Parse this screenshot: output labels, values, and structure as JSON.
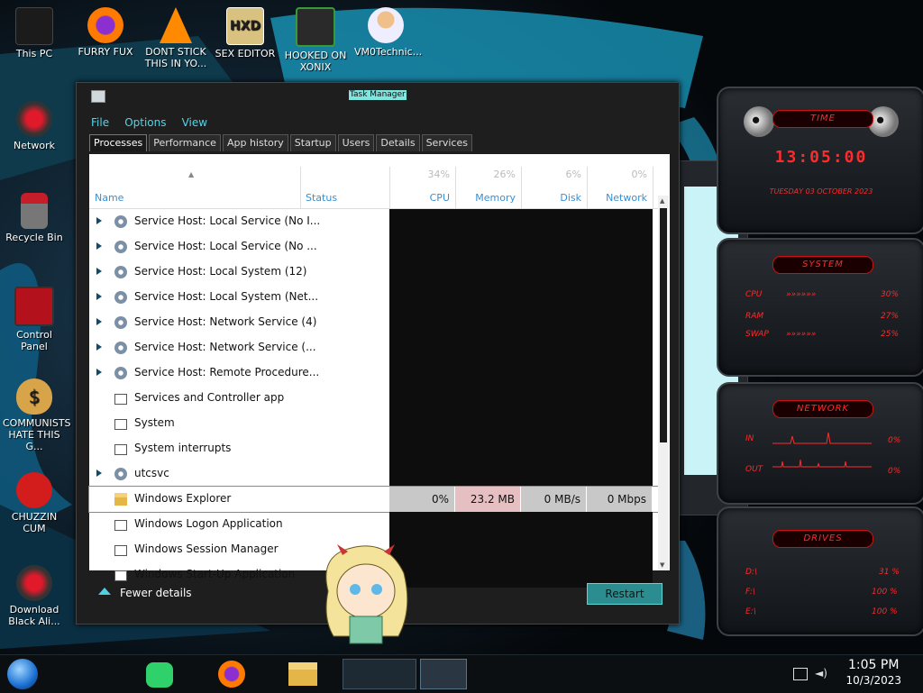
{
  "desktop_icons": [
    {
      "label": "This PC",
      "color": "#1b1b1b"
    },
    {
      "label": "FURRY FUX",
      "color": "#ff7a00"
    },
    {
      "label": "DONT STICK THIS IN YO...",
      "color": "#ff8a00"
    },
    {
      "label": "SEX EDITOR",
      "color": "#c9a84a"
    },
    {
      "label": "HOOKED ON XONIX",
      "color": "#2a7a2a"
    },
    {
      "label": "VM0Technic...",
      "color": "#e6e6e6"
    },
    {
      "label": "Network",
      "color": "#a0101a"
    },
    {
      "label": "Recycle Bin",
      "color": "#c51d2a"
    },
    {
      "label": "Control Panel",
      "color": "#b3121c"
    },
    {
      "label": "COMMUNISTS HATE THIS G...",
      "color": "#d8a449"
    },
    {
      "label": "CHUZZIN CUM",
      "color": "#d31c1c"
    },
    {
      "label": "Download Black Ali...",
      "color": "#a0101a"
    }
  ],
  "gadgets": {
    "time_title": "TIME",
    "time_value": "13:05:00",
    "date_value": "TUESDAY 03 OCTOBER 2023",
    "system_title": "SYSTEM",
    "system_rows": [
      {
        "label": "CPU",
        "value": "30%"
      },
      {
        "label": "RAM",
        "value": "27%"
      },
      {
        "label": "SWAP",
        "value": "25%"
      }
    ],
    "network_title": "NETWORK",
    "network_rows": [
      {
        "label": "IN",
        "value": "0%"
      },
      {
        "label": "OUT",
        "value": "0%"
      }
    ],
    "drives_title": "DRIVES",
    "drives_rows": [
      {
        "label": "D:\\",
        "value": "31 %"
      },
      {
        "label": "F:\\",
        "value": "100 %"
      },
      {
        "label": "E:\\",
        "value": "100 %"
      }
    ]
  },
  "window": {
    "title": "Task Manager",
    "menu": [
      "File",
      "Options",
      "View"
    ],
    "tabs": [
      "Processes",
      "Performance",
      "App history",
      "Startup",
      "Users",
      "Details",
      "Services"
    ],
    "active_tab": "Processes",
    "columns": {
      "name": "Name",
      "status": "Status",
      "cpu_pct": "34%",
      "cpu": "CPU",
      "memory_pct": "26%",
      "memory": "Memory",
      "disk_pct": "6%",
      "disk": "Disk",
      "network_pct": "0%",
      "network": "Network"
    },
    "processes": [
      {
        "name": "Service Host: Local Service (No I...",
        "expandable": true,
        "icon": "gear-icon"
      },
      {
        "name": "Service Host: Local Service (No ...",
        "expandable": true,
        "icon": "gear-icon"
      },
      {
        "name": "Service Host: Local System (12)",
        "expandable": true,
        "icon": "gear-icon"
      },
      {
        "name": "Service Host: Local System (Net...",
        "expandable": true,
        "icon": "gear-icon"
      },
      {
        "name": "Service Host: Network Service (4)",
        "expandable": true,
        "icon": "gear-icon"
      },
      {
        "name": "Service Host: Network Service (...",
        "expandable": true,
        "icon": "gear-icon"
      },
      {
        "name": "Service Host: Remote Procedure...",
        "expandable": true,
        "icon": "gear-icon"
      },
      {
        "name": "Services and Controller app",
        "expandable": false,
        "icon": "app-window-icon"
      },
      {
        "name": "System",
        "expandable": false,
        "icon": "app-window-icon"
      },
      {
        "name": "System interrupts",
        "expandable": false,
        "icon": "app-window-icon"
      },
      {
        "name": "utcsvc",
        "expandable": true,
        "icon": "gear-icon"
      },
      {
        "name": "Windows Explorer",
        "expandable": false,
        "icon": "folder-icon",
        "selected": true,
        "cpu": "0%",
        "memory": "23.2 MB",
        "disk": "0 MB/s",
        "network": "0 Mbps"
      },
      {
        "name": "Windows Logon Application",
        "expandable": false,
        "icon": "app-window-icon"
      },
      {
        "name": "Windows Session Manager",
        "expandable": false,
        "icon": "app-window-icon"
      },
      {
        "name": "Windows Start-Up Application",
        "expandable": false,
        "icon": "app-window-icon"
      }
    ],
    "fewer_details": "Fewer details",
    "restart": "Restart"
  },
  "taskbar": {
    "time": "1:05 PM",
    "date": "10/3/2023",
    "apps": [
      "start-orb-icon",
      "notes-app-icon",
      "firefox-icon",
      "file-explorer-icon",
      "control-panel-icon",
      "task-manager-icon"
    ]
  }
}
